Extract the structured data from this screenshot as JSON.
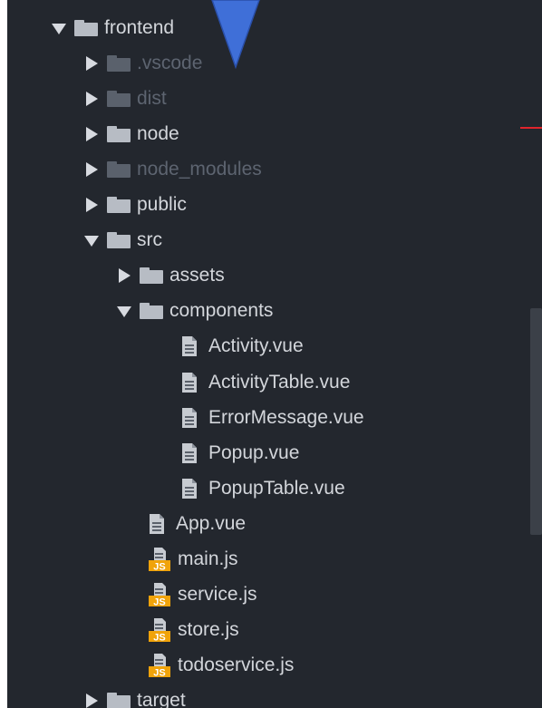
{
  "tree": {
    "items": [
      {
        "label": "frontend",
        "type": "folder",
        "state": "expanded",
        "level": 0,
        "ignored": false
      },
      {
        "label": ".vscode",
        "type": "folder",
        "state": "collapsed",
        "level": 1,
        "ignored": true
      },
      {
        "label": "dist",
        "type": "folder",
        "state": "collapsed",
        "level": 1,
        "ignored": true
      },
      {
        "label": "node",
        "type": "folder",
        "state": "collapsed",
        "level": 1,
        "ignored": false
      },
      {
        "label": "node_modules",
        "type": "folder",
        "state": "collapsed",
        "level": 1,
        "ignored": true
      },
      {
        "label": "public",
        "type": "folder",
        "state": "collapsed",
        "level": 1,
        "ignored": false
      },
      {
        "label": "src",
        "type": "folder",
        "state": "expanded",
        "level": 1,
        "ignored": false
      },
      {
        "label": "assets",
        "type": "folder",
        "state": "collapsed",
        "level": 2,
        "ignored": false
      },
      {
        "label": "components",
        "type": "folder",
        "state": "expanded",
        "level": 2,
        "ignored": false
      },
      {
        "label": "Activity.vue",
        "type": "file",
        "level": 3,
        "ignored": false
      },
      {
        "label": "ActivityTable.vue",
        "type": "file",
        "level": 3,
        "ignored": false
      },
      {
        "label": "ErrorMessage.vue",
        "type": "file",
        "level": 3,
        "ignored": false
      },
      {
        "label": "Popup.vue",
        "type": "file",
        "level": 3,
        "ignored": false
      },
      {
        "label": "PopupTable.vue",
        "type": "file",
        "level": 3,
        "ignored": false
      },
      {
        "label": "App.vue",
        "type": "file",
        "level": 2,
        "ignored": false
      },
      {
        "label": "main.js",
        "type": "js",
        "level": 2,
        "ignored": false
      },
      {
        "label": "service.js",
        "type": "js",
        "level": 2,
        "ignored": false
      },
      {
        "label": "store.js",
        "type": "js",
        "level": 2,
        "ignored": false
      },
      {
        "label": "todoservice.js",
        "type": "js",
        "level": 2,
        "ignored": false
      },
      {
        "label": "target",
        "type": "folder",
        "state": "collapsed",
        "level": 1,
        "ignored": false
      }
    ]
  },
  "icons": {
    "folder": "folder-icon",
    "file": "file-icon",
    "js": "js-file-icon",
    "expanded": "triangle-down-icon",
    "collapsed": "triangle-right-icon"
  },
  "js_badge": "JS",
  "colors": {
    "panel_bg": "#23272e",
    "text": "#d3d6db",
    "ignored_text": "#5d6470",
    "js_badge": "#f0a30a",
    "pointer": "#3f6fd8",
    "marker": "#e0242c"
  }
}
